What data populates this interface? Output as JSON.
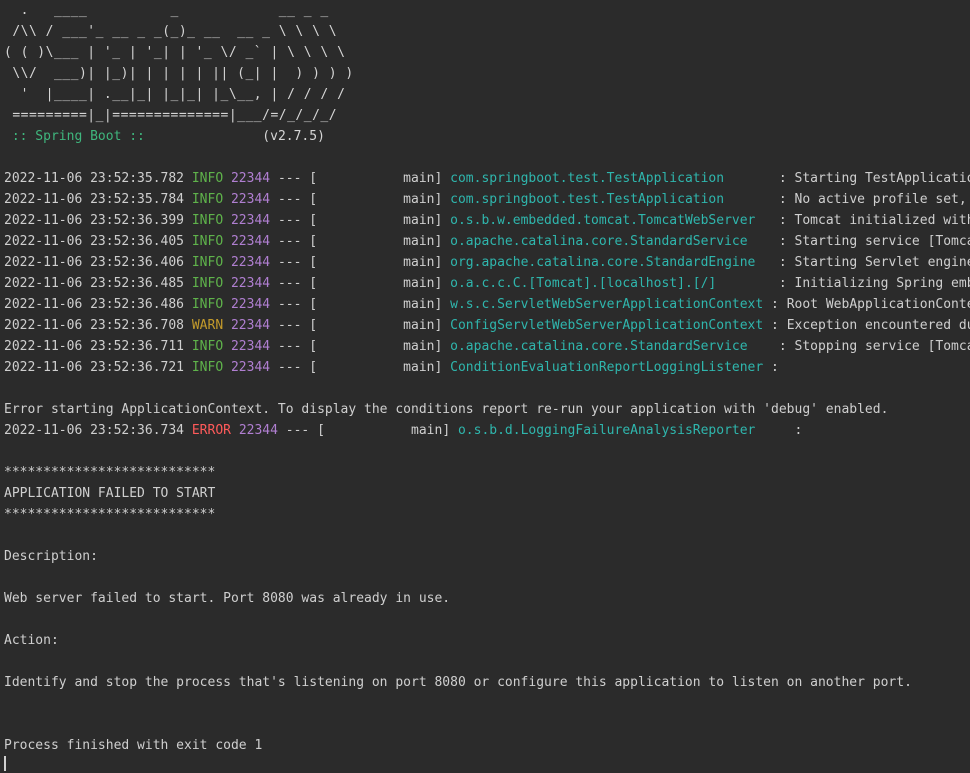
{
  "banner": {
    "lines": [
      "  .   ____          _            __ _ _",
      " /\\\\ / ___'_ __ _ _(_)_ __  __ _ \\ \\ \\ \\",
      "( ( )\\___ | '_ | '_| | '_ \\/ _` | \\ \\ \\ \\",
      " \\\\/  ___)| |_)| | | | | || (_| |  ) ) ) )",
      "  '  |____| .__|_| |_|_| |_\\__, | / / / /",
      " =========|_|==============|___/=/_/_/_/"
    ],
    "spring_label": " :: Spring Boot :: ",
    "version": "              (v2.7.5)"
  },
  "logs": [
    {
      "timestamp": "2022-11-06 23:52:35.782",
      "level": "INFO",
      "level_text": " INFO",
      "pid": "22344",
      "thread": " --- [           main] ",
      "logger": "com.springboot.test.TestApplication      ",
      "message": " : Starting TestApplication using Java"
    },
    {
      "timestamp": "2022-11-06 23:52:35.784",
      "level": "INFO",
      "level_text": " INFO",
      "pid": "22344",
      "thread": " --- [           main] ",
      "logger": "com.springboot.test.TestApplication      ",
      "message": " : No active profile set, falling back"
    },
    {
      "timestamp": "2022-11-06 23:52:36.399",
      "level": "INFO",
      "level_text": " INFO",
      "pid": "22344",
      "thread": " --- [           main] ",
      "logger": "o.s.b.w.embedded.tomcat.TomcatWebServer  ",
      "message": " : Tomcat initialized with port(s)"
    },
    {
      "timestamp": "2022-11-06 23:52:36.405",
      "level": "INFO",
      "level_text": " INFO",
      "pid": "22344",
      "thread": " --- [           main] ",
      "logger": "o.apache.catalina.core.StandardService   ",
      "message": " : Starting service [Tomcat]"
    },
    {
      "timestamp": "2022-11-06 23:52:36.406",
      "level": "INFO",
      "level_text": " INFO",
      "pid": "22344",
      "thread": " --- [           main] ",
      "logger": "org.apache.catalina.core.StandardEngine  ",
      "message": " : Starting Servlet engine"
    },
    {
      "timestamp": "2022-11-06 23:52:36.485",
      "level": "INFO",
      "level_text": " INFO",
      "pid": "22344",
      "thread": " --- [           main] ",
      "logger": "o.a.c.c.C.[Tomcat].[localhost].[/]       ",
      "message": " : Initializing Spring embedded"
    },
    {
      "timestamp": "2022-11-06 23:52:36.486",
      "level": "INFO",
      "level_text": " INFO",
      "pid": "22344",
      "thread": " --- [           main] ",
      "logger": "w.s.c.ServletWebServerApplicationContext ",
      "message": ": Root WebApplicationContext"
    },
    {
      "timestamp": "2022-11-06 23:52:36.708",
      "level": "WARN",
      "level_text": " WARN",
      "pid": "22344",
      "thread": " --- [           main] ",
      "logger": "ConfigServletWebServerApplicationContext ",
      "message": ": Exception encountered during"
    },
    {
      "timestamp": "2022-11-06 23:52:36.711",
      "level": "INFO",
      "level_text": " INFO",
      "pid": "22344",
      "thread": " --- [           main] ",
      "logger": "o.apache.catalina.core.StandardService   ",
      "message": " : Stopping service [Tomcat]"
    },
    {
      "timestamp": "2022-11-06 23:52:36.721",
      "level": "INFO",
      "level_text": " INFO",
      "pid": "22344",
      "thread": " --- [           main] ",
      "logger": "ConditionEvaluationReportLoggingListener ",
      "message": ": "
    }
  ],
  "error_context_message": "Error starting ApplicationContext. To display the conditions report re-run your application with 'debug' enabled.",
  "error_log": {
    "timestamp": "2022-11-06 23:52:36.734",
    "level": "ERROR",
    "level_text": " ERROR",
    "pid": "22344",
    "thread": " --- [           main] ",
    "logger": "o.s.b.d.LoggingFailureAnalysisReporter   ",
    "message": "  : "
  },
  "failure": {
    "stars": "***************************",
    "title": "APPLICATION FAILED TO START",
    "description_label": "Description:",
    "description": "Web server failed to start. Port 8080 was already in use.",
    "action_label": "Action:",
    "action": "Identify and stop the process that's listening on port 8080 or configure this application to listen on another port."
  },
  "exit_message": "Process finished with exit code 1"
}
